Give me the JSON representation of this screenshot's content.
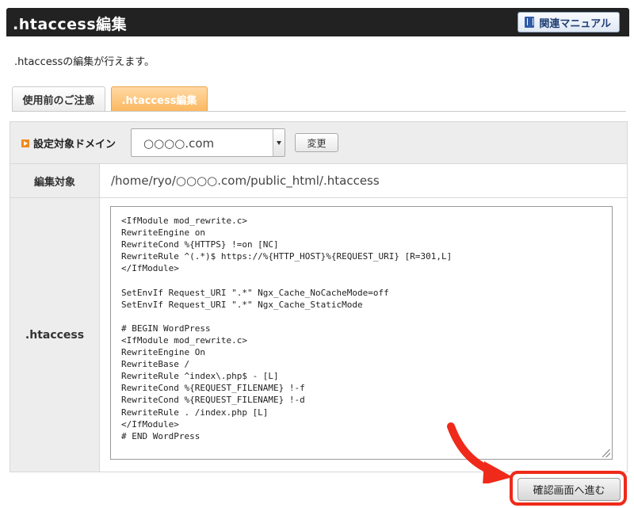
{
  "header": {
    "title": ".htaccess編集",
    "manual_button": "関連マニュアル"
  },
  "intro_text": ".htaccessの編集が行えます。",
  "tabs": [
    {
      "label": "使用前のご注意",
      "active": false
    },
    {
      "label": ".htaccess編集",
      "active": true
    }
  ],
  "domain_row": {
    "label": "設定対象ドメイン",
    "selected": "○○○○.com",
    "change_button": "変更"
  },
  "target_row": {
    "label": "編集対象",
    "path": "/home/ryo/○○○○.com/public_html/.htaccess"
  },
  "htaccess_row": {
    "label": ".htaccess",
    "content": "<IfModule mod_rewrite.c>\nRewriteEngine on\nRewriteCond %{HTTPS} !=on [NC]\nRewriteRule ^(.*)$ https://%{HTTP_HOST}%{REQUEST_URI} [R=301,L]\n</IfModule>\n\nSetEnvIf Request_URI \".*\" Ngx_Cache_NoCacheMode=off\nSetEnvIf Request_URI \".*\" Ngx_Cache_StaticMode\n\n# BEGIN WordPress\n<IfModule mod_rewrite.c>\nRewriteEngine On\nRewriteBase /\nRewriteRule ^index\\.php$ - [L]\nRewriteCond %{REQUEST_FILENAME} !-f\nRewriteCond %{REQUEST_FILENAME} !-d\nRewriteRule . /index.php [L]\n</IfModule>\n# END WordPress"
  },
  "confirm_button": "確認画面へ進む",
  "colors": {
    "header_bg": "#222222",
    "tab_active": "#fbb861",
    "highlight": "#ef2a1a"
  }
}
